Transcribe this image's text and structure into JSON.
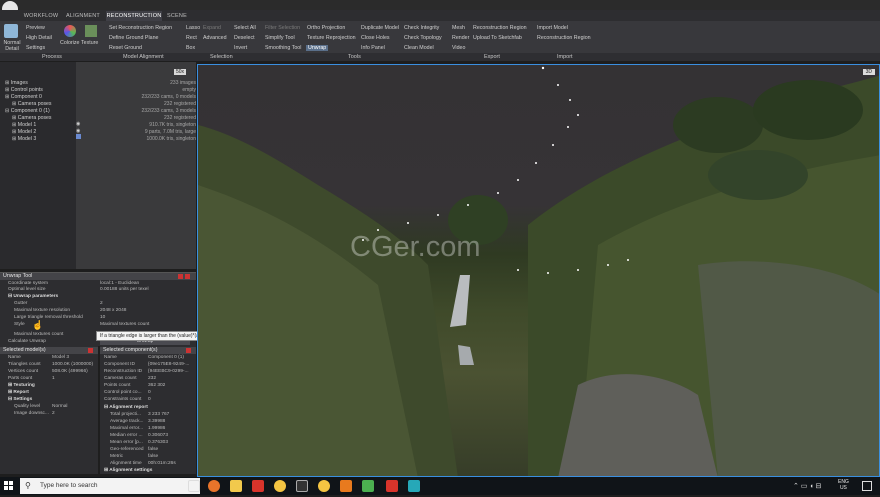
{
  "ribbon": {
    "tabs": [
      "WORKFLOW",
      "ALIGNMENT",
      "RECONSTRUCTION",
      "SCENE"
    ],
    "active_tab": "RECONSTRUCTION",
    "process": {
      "normal_detail": "Normal Detail",
      "preview": "Preview",
      "high_detail": "High Detail",
      "settings": "Settings",
      "colorize": "Colorize",
      "texture": "Texture"
    },
    "model_alignment": {
      "set_region": "Set Reconstruction Region",
      "define_ground": "Define Ground Plane",
      "reset_ground": "Reset Ground"
    },
    "selection": {
      "lasso": "Lasso",
      "expand": "Expand",
      "rect": "Rect",
      "advanced": "Advanced",
      "box": "Box",
      "select_all": "Select All",
      "deselect": "Deselect",
      "invert": "Invert",
      "filter_selection": "Filter Selection"
    },
    "tools": {
      "simplify": "Simplify Tool",
      "smoothing": "Smoothing Tool",
      "ortho": "Ortho Projection",
      "texture_reproj": "Texture Reprojection",
      "unwrap": "Unwrap",
      "duplicate": "Duplicate Model",
      "close_holes": "Close Holes",
      "info_panel": "Info Panel",
      "check_integrity": "Check Integrity",
      "check_topology": "Check Topology",
      "clean_model": "Clean Model"
    },
    "export": {
      "mesh": "Mesh",
      "render": "Render",
      "video": "Video",
      "recon_region": "Reconstruction Region",
      "upload_sketchfab": "Upload To Sketchfab"
    },
    "import": {
      "import_model": "Import Model",
      "recon_region": "Reconstruction Region"
    },
    "groups": [
      "Process",
      "Model Alignment",
      "Selection",
      "Tools",
      "Export",
      "Import"
    ]
  },
  "tree": {
    "zoom_label": "50x",
    "items": [
      {
        "label": "Images",
        "value": "233 images"
      },
      {
        "label": "Control points",
        "value": "empty"
      },
      {
        "label": "Component 0",
        "value": "232/233 cams, 0 models"
      },
      {
        "label": "Camera poses",
        "value": "232 registered"
      },
      {
        "label": "Component 0 (1)",
        "value": "232/233 cams, 3 models"
      },
      {
        "label": "Camera poses",
        "value": "232 registered"
      },
      {
        "label": "Model 1",
        "value": "910.7K tris, singleton"
      },
      {
        "label": "Model 2",
        "value": "9 parts, 7.0M tris, large"
      },
      {
        "label": "Model 3",
        "value": "1000.0K tris, singleton"
      }
    ]
  },
  "unwrap": {
    "title": "Unwrap Tool",
    "rows": [
      {
        "k": "Coordinate system",
        "v": "local:1 - Euclidean"
      },
      {
        "k": "Optimal level size",
        "v": "0.00188 units per texel"
      },
      {
        "k": "Unwrap parameters",
        "v": ""
      },
      {
        "k": "Gutter",
        "v": "2"
      },
      {
        "k": "Maximal texture resolution",
        "v": "2048 x 2048"
      },
      {
        "k": "Large triangle removal threshold",
        "v": "10"
      },
      {
        "k": "Style",
        "v": ""
      },
      {
        "k": "Maximal textures count",
        "v": "Maximal textures count"
      },
      {
        "k": "Calculate Unwrap",
        "v": "Unwrap"
      }
    ],
    "tooltip": "If a triangle edge is larger than the (value)*(average edge length), then the triangle is textured by one texel."
  },
  "selected_model": {
    "title": "Selected model(s)",
    "rows": [
      {
        "k": "Name",
        "v": "Model 3"
      },
      {
        "k": "Triangles count",
        "v": "1000.0K (1000000)"
      },
      {
        "k": "Vertices count",
        "v": "508.0K (499966)"
      },
      {
        "k": "Parts count",
        "v": "1"
      },
      {
        "k": "Texturing",
        "v": ""
      },
      {
        "k": "Report",
        "v": ""
      },
      {
        "k": "Settings",
        "v": ""
      },
      {
        "k": "Quality level",
        "v": "Normal"
      },
      {
        "k": "Image downsc...",
        "v": "2"
      }
    ]
  },
  "selected_component": {
    "title": "Selected component(s)",
    "rows": [
      {
        "k": "Name",
        "v": "Component 0 (1)"
      },
      {
        "k": "Component ID",
        "v": "{09e175E8-9249-..."
      },
      {
        "k": "Reconstruction ID",
        "v": "{94EEBC9-0299-..."
      },
      {
        "k": "Cameras count",
        "v": "232"
      },
      {
        "k": "Points count",
        "v": "362 302"
      },
      {
        "k": "Control point co...",
        "v": "0"
      },
      {
        "k": "Constraints count",
        "v": "0"
      },
      {
        "k": "Alignment report",
        "v": ""
      },
      {
        "k": "Total projecti...",
        "v": "3 233 767"
      },
      {
        "k": "Average track...",
        "v": "3.39988"
      },
      {
        "k": "Maximal error...",
        "v": "1.99986"
      },
      {
        "k": "Median error ...",
        "v": "0.306073"
      },
      {
        "k": "Mean error [p...",
        "v": "0.376303"
      },
      {
        "k": "Geo-referenced",
        "v": "false"
      },
      {
        "k": "Metric",
        "v": "false"
      },
      {
        "k": "Alignment time",
        "v": "00h:01m:26s"
      },
      {
        "k": "Alignment settings",
        "v": ""
      }
    ]
  },
  "viewport": {
    "mode_label": "3D"
  },
  "watermark": "CGer.com",
  "brand": "fxphd",
  "taskbar": {
    "search_placeholder": "Type here to search",
    "lang": "ENG",
    "region": "US"
  }
}
